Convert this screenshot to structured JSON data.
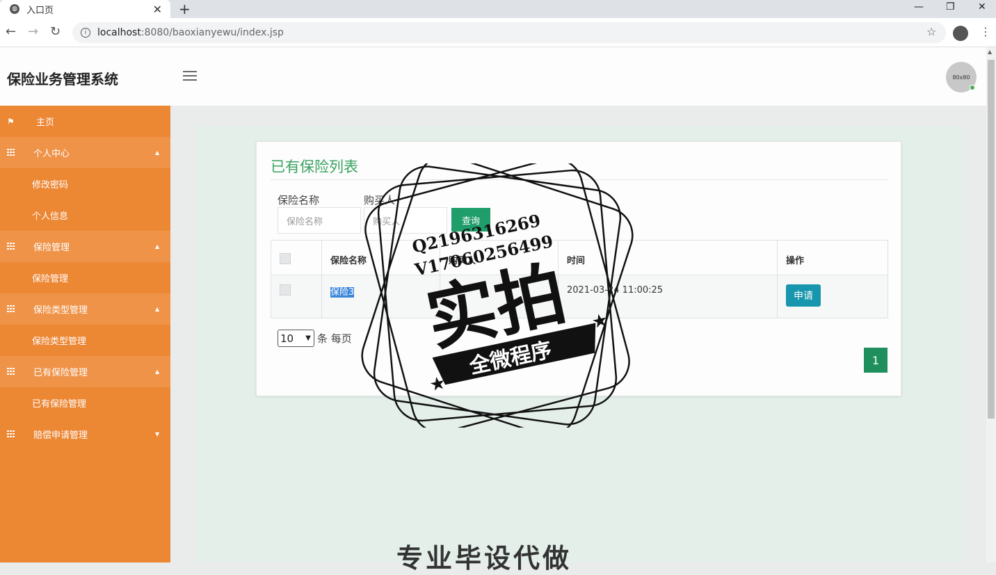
{
  "browser": {
    "tab_title": "入口页",
    "url_host": "localhost",
    "url_rest": ":8080/baoxianyewu/index.jsp"
  },
  "header": {
    "brand": "保险业务管理系统",
    "avatar_text": "80x80"
  },
  "sidebar": {
    "items": [
      {
        "label": "主页",
        "type": "home"
      },
      {
        "label": "个人中心",
        "type": "parent"
      },
      {
        "label": "修改密码",
        "type": "sub"
      },
      {
        "label": "个人信息",
        "type": "sub"
      },
      {
        "label": "保险管理",
        "type": "parent"
      },
      {
        "label": "保险管理",
        "type": "sub"
      },
      {
        "label": "保险类型管理",
        "type": "parent"
      },
      {
        "label": "保险类型管理",
        "type": "sub"
      },
      {
        "label": "已有保险管理",
        "type": "parent"
      },
      {
        "label": "已有保险管理",
        "type": "sub"
      },
      {
        "label": "赔偿申请管理",
        "type": "parent-collapsed"
      }
    ]
  },
  "card": {
    "title": "已有保险列表",
    "filters": [
      {
        "label": "保险名称",
        "placeholder": "保险名称"
      },
      {
        "label": "购买人",
        "placeholder": "购买人"
      }
    ],
    "search_label": "查询"
  },
  "table": {
    "headers": [
      "保险名称",
      "购买人",
      "时间",
      "操作"
    ],
    "rows": [
      {
        "name": "保险3",
        "buyer": "",
        "time": "2021-03-24 11:00:25",
        "action": "申请"
      }
    ]
  },
  "pager": {
    "page_size": "10",
    "page_size_suffix": "条 每页",
    "current_page": "1"
  },
  "watermark": {
    "line1": "Q2196316269",
    "line2": "V17060256499",
    "big": "实拍",
    "ribbon": "全微程序"
  },
  "bottom_text": "专业毕设代做",
  "colors": {
    "sidebar": "#ec8734",
    "accent_green": "#3aa260",
    "apply_button": "#1796ad"
  }
}
